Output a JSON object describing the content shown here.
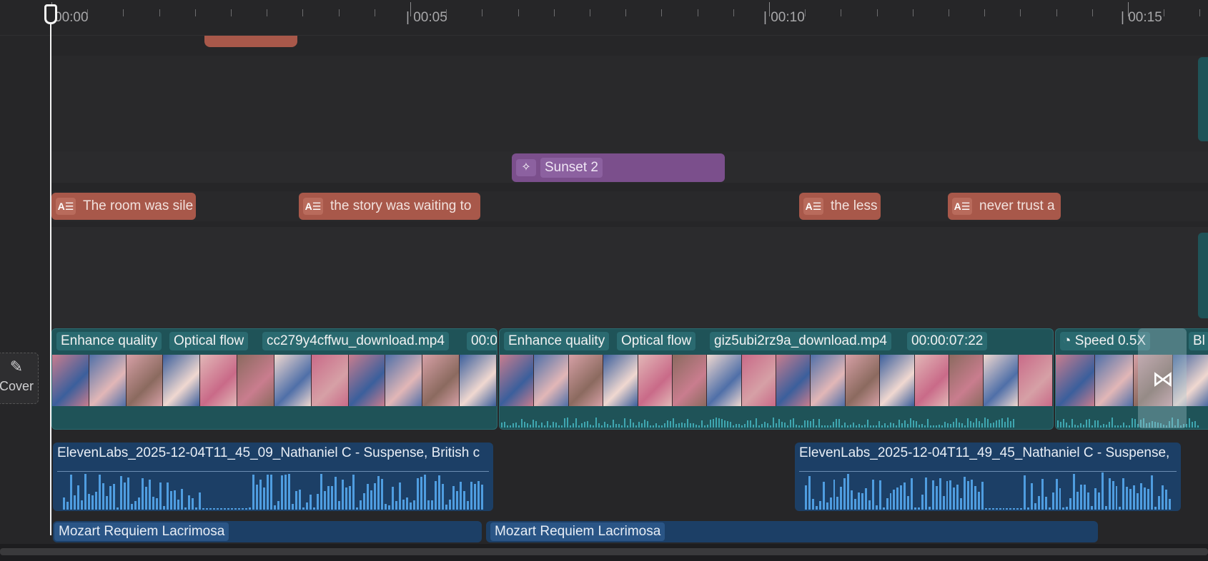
{
  "ruler": {
    "labels": [
      "00:00",
      "| 00:05",
      "| 00:10",
      "| 00:15"
    ]
  },
  "cover": {
    "label": "Cover",
    "icon": "edit-icon"
  },
  "effect_track": {
    "clips": [
      {
        "label": "Sunset 2",
        "icon": "effect-star-icon"
      }
    ]
  },
  "text_track": {
    "clips": [
      {
        "label": "The room was sile",
        "icon": "text-template-icon"
      },
      {
        "label": "the story was waiting to",
        "icon": "text-template-icon"
      },
      {
        "label": "the less",
        "icon": "text-template-icon"
      },
      {
        "label": "never trust a",
        "icon": "text-template-icon"
      }
    ]
  },
  "video_track": {
    "clips": [
      {
        "tags": [
          "Enhance quality",
          "Optical flow",
          "cc279y4cffwu_download.mp4",
          "00:0"
        ]
      },
      {
        "tags": [
          "Enhance quality",
          "Optical flow",
          "giz5ubi2rz9a_download.mp4",
          "00:00:07:22"
        ]
      },
      {
        "tags": [
          "Speed 0.5X",
          "Bl"
        ],
        "icon": "speed-gauge-icon"
      }
    ]
  },
  "voice_track": {
    "clips": [
      {
        "title": "ElevenLabs_2025-12-04T11_45_09_Nathaniel C - Suspense, British c"
      },
      {
        "title": "ElevenLabs_2025-12-04T11_49_45_Nathaniel C - Suspense,"
      }
    ]
  },
  "music_track": {
    "clips": [
      {
        "title": "Mozart Requiem Lacrimosa"
      },
      {
        "title": "Mozart Requiem Lacrimosa"
      }
    ]
  },
  "colors": {
    "background": "#262628",
    "text_clip": "#a8584a",
    "effect_clip": "#7b4f8c",
    "video_clip": "#1f5358",
    "audio_clip": "#1c3f66",
    "waveform": "#4f9de0",
    "playhead": "#f4f4f4"
  }
}
